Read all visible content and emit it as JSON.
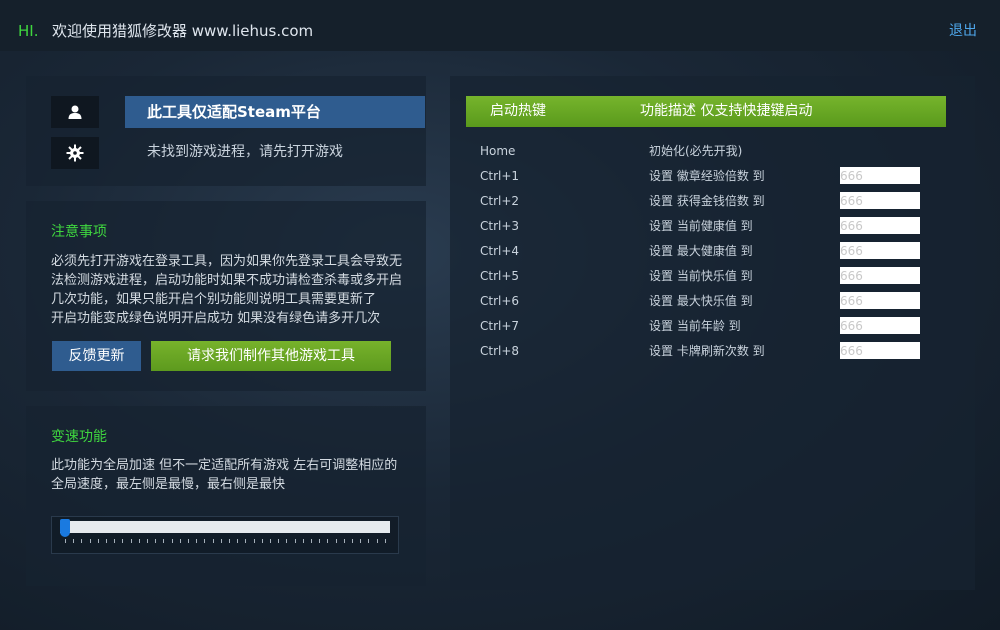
{
  "topbar": {
    "hi": "HI.",
    "welcome": "欢迎使用猎狐修改器 www.liehus.com",
    "logout": "退出"
  },
  "platform": {
    "title": "此工具仅适配Steam平台",
    "status": "未找到游戏进程，请先打开游戏",
    "icons": [
      "user-icon",
      "gear-icon"
    ]
  },
  "notice": {
    "title": "注意事项",
    "lines": [
      "必须先打开游戏在登录工具，因为如果你先登录工具会导致无",
      "法检测游戏进程，启动功能时如果不成功请检查杀毒或多开启",
      "几次功能，如果只能开启个别功能则说明工具需要更新了",
      "开启功能变成绿色说明开启成功 如果没有绿色请多开几次"
    ],
    "feedback_button": "反馈更新",
    "request_button": "请求我们制作其他游戏工具"
  },
  "speed": {
    "title": "变速功能",
    "lines": [
      "此功能为全局加速 但不一定适配所有游戏 左右可调整相应的",
      "全局速度，最左侧是最慢，最右侧是最快"
    ],
    "slider_value": 0
  },
  "hotkeys": {
    "header_key": "启动热键",
    "header_desc": "功能描述 仅支持快捷键启动",
    "rows": [
      {
        "key": "Home",
        "desc": "初始化(必先开我)",
        "placeholder": ""
      },
      {
        "key": "Ctrl+1",
        "desc": "设置 徽章经验倍数 到",
        "placeholder": "666"
      },
      {
        "key": "Ctrl+2",
        "desc": "设置 获得金钱倍数 到",
        "placeholder": "666"
      },
      {
        "key": "Ctrl+3",
        "desc": "设置 当前健康值 到",
        "placeholder": "666"
      },
      {
        "key": "Ctrl+4",
        "desc": "设置 最大健康值 到",
        "placeholder": "666"
      },
      {
        "key": "Ctrl+5",
        "desc": "设置 当前快乐值 到",
        "placeholder": "666"
      },
      {
        "key": "Ctrl+6",
        "desc": "设置 最大快乐值 到",
        "placeholder": "666"
      },
      {
        "key": "Ctrl+7",
        "desc": "设置 当前年龄 到",
        "placeholder": "666"
      },
      {
        "key": "Ctrl+8",
        "desc": "设置 卡牌刷新次数 到",
        "placeholder": "666"
      }
    ]
  },
  "colors": {
    "accent_green": "#3fd63f",
    "header_green": "#6aa924",
    "button_blue": "#2f5c8f",
    "link_blue": "#4ea6ea",
    "slider_blue": "#1a7ae0"
  }
}
